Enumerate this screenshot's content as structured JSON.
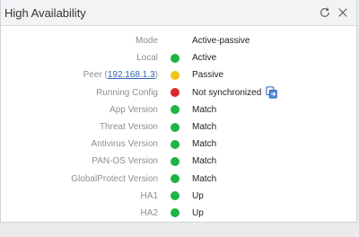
{
  "widget": {
    "title": "High Availability",
    "icons": {
      "refresh": "refresh-icon",
      "close": "close-icon"
    }
  },
  "colors": {
    "green": "#1fb344",
    "yellow": "#f2c418",
    "red": "#d9272e",
    "link": "#2f62b7"
  },
  "rows": [
    {
      "label": "Mode",
      "status": "none",
      "value": "Active-passive"
    },
    {
      "label": "Local",
      "status": "green",
      "value": "Active"
    },
    {
      "label_prefix": "Peer (",
      "link": "192.168.1.3",
      "label_suffix": ")",
      "status": "yellow",
      "value": "Passive"
    },
    {
      "label": "Running Config",
      "status": "red",
      "value": "Not synchronized",
      "action_icon": "sync-config-icon"
    },
    {
      "label": "App Version",
      "status": "green",
      "value": "Match"
    },
    {
      "label": "Threat Version",
      "status": "green",
      "value": "Match"
    },
    {
      "label": "Antivirus Version",
      "status": "green",
      "value": "Match"
    },
    {
      "label": "PAN-OS Version",
      "status": "green",
      "value": "Match"
    },
    {
      "label": "GlobalProtect Version",
      "status": "green",
      "value": "Match"
    },
    {
      "label": "HA1",
      "status": "green",
      "value": "Up"
    },
    {
      "label": "HA2",
      "status": "green",
      "value": "Up"
    }
  ]
}
